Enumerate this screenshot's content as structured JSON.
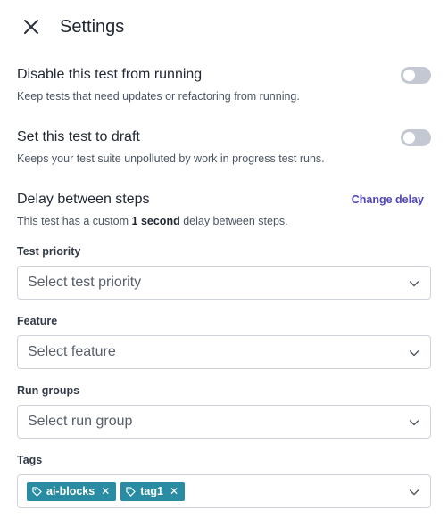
{
  "header": {
    "title": "Settings",
    "close_icon": "close-icon"
  },
  "disable_test": {
    "title": "Disable this test from running",
    "description": "Keep tests that need updates or refactoring from running.",
    "enabled": false
  },
  "draft": {
    "title": "Set this test to draft",
    "description": "Keeps your test suite unpolluted by work in progress test runs.",
    "enabled": false
  },
  "delay": {
    "title": "Delay between steps",
    "link": "Change delay",
    "desc_prefix": "This test has a custom ",
    "desc_value": "1 second",
    "desc_suffix": " delay between steps."
  },
  "fields": {
    "priority": {
      "label": "Test priority",
      "placeholder": "Select test priority"
    },
    "feature": {
      "label": "Feature",
      "placeholder": "Select feature"
    },
    "run_groups": {
      "label": "Run groups",
      "placeholder": "Select run group"
    },
    "tags": {
      "label": "Tags",
      "items": [
        "ai-blocks",
        "tag1"
      ]
    }
  },
  "colors": {
    "accent": "#4f46b8",
    "tag_bg": "#2a8ca3",
    "toggle_off": "#c3c8d3"
  }
}
